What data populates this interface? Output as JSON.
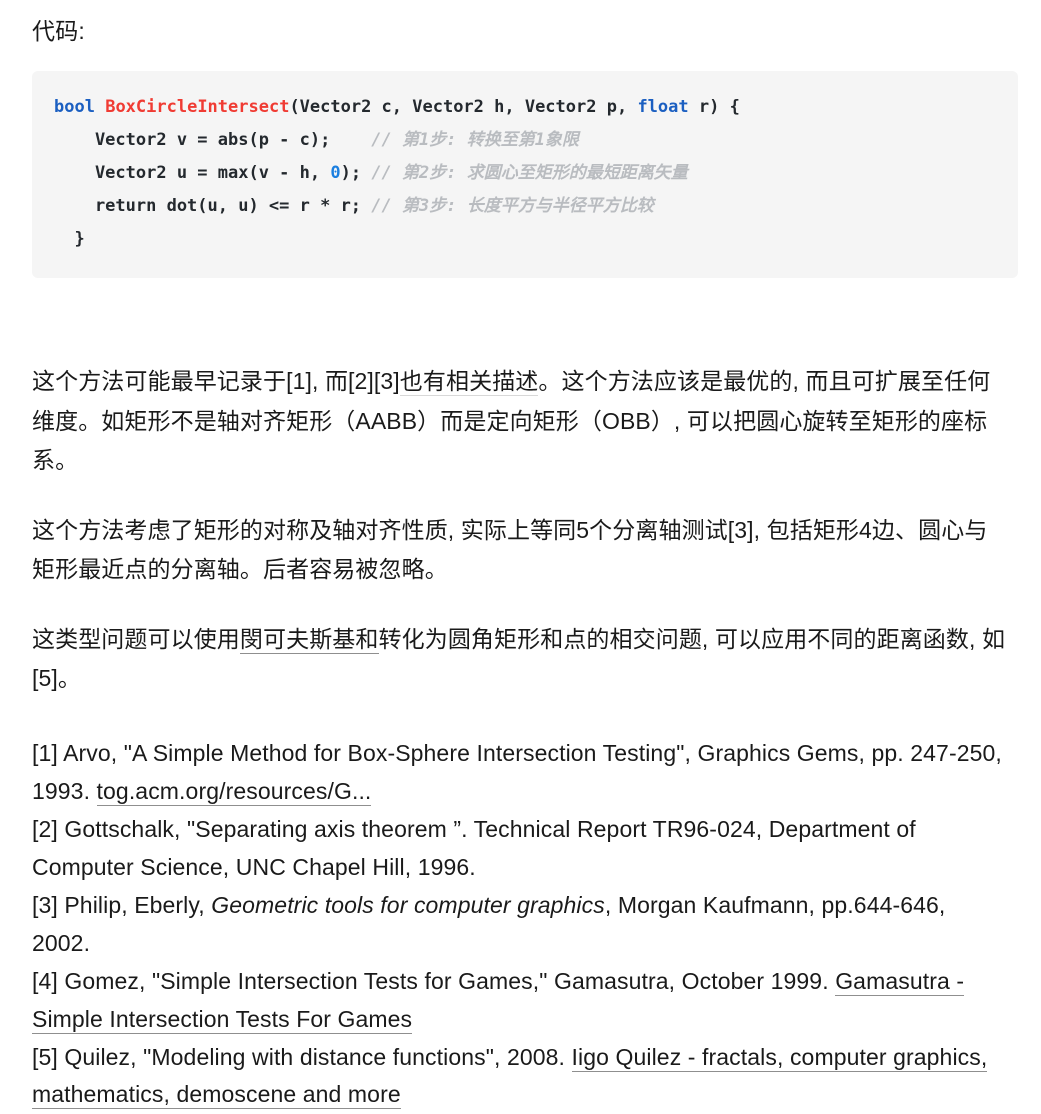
{
  "intro": {
    "label": "代码:"
  },
  "code": {
    "language": "cpp",
    "lines": [
      {
        "tokens": [
          {
            "t": "bool",
            "k": "kw"
          },
          {
            "t": " ",
            "k": "plain"
          },
          {
            "t": "BoxCircleIntersect",
            "k": "fn"
          },
          {
            "t": "(Vector2 c, Vector2 h, Vector2 p, ",
            "k": "plain"
          },
          {
            "t": "float",
            "k": "kw"
          },
          {
            "t": " r) {",
            "k": "plain"
          }
        ]
      },
      {
        "tokens": [
          {
            "t": "    Vector2 v = abs(p - c);    ",
            "k": "plain"
          },
          {
            "t": "// 第1步: 转换至第1象限",
            "k": "cmt"
          }
        ]
      },
      {
        "tokens": [
          {
            "t": "    Vector2 u = max(v - h, ",
            "k": "plain"
          },
          {
            "t": "0",
            "k": "num"
          },
          {
            "t": "); ",
            "k": "plain"
          },
          {
            "t": "// 第2步: 求圆心至矩形的最短距离矢量",
            "k": "cmt"
          }
        ]
      },
      {
        "tokens": [
          {
            "t": "    return dot(u, u) <= r * r; ",
            "k": "plain"
          },
          {
            "t": "// 第3步: 长度平方与半径平方比较",
            "k": "cmt"
          }
        ]
      },
      {
        "tokens": [
          {
            "t": "  }",
            "k": "plain"
          }
        ]
      }
    ]
  },
  "paragraphs": [
    {
      "id": "para-origin",
      "runs": [
        {
          "t": "这个方法可能最早记录于[1], 而[2][3]",
          "style": "plain"
        },
        {
          "t": "也有相关描述",
          "style": "link-faint"
        },
        {
          "t": "。这个方法应该是最优的, 而且可扩展至任何维度。如矩形不是轴对齐矩形（AABB）而是定向矩形（OBB）, 可以把圆心旋转至矩形的座标系。",
          "style": "plain"
        }
      ]
    },
    {
      "id": "para-sat",
      "runs": [
        {
          "t": "这个方法考虑了矩形的对称及轴对齐性质, 实际上等同5个分离轴测试[3], 包括矩形4边、圆心与矩形最近点的分离轴。后者容易被忽略。",
          "style": "plain"
        }
      ]
    },
    {
      "id": "para-minkowski",
      "runs": [
        {
          "t": "这类型问题可以使用",
          "style": "plain"
        },
        {
          "t": "閔可夫斯基和",
          "style": "link"
        },
        {
          "t": "转化为圆角矩形和点的相交问题, 可以应用不同的距离函数, 如[5]。",
          "style": "plain"
        }
      ]
    }
  ],
  "references": [
    {
      "id": "ref-1",
      "runs": [
        {
          "t": "[1] Arvo, \"A Simple Method for Box-Sphere Intersection Testing\", Graphics Gems, pp. 247-250, 1993. ",
          "style": "plain"
        },
        {
          "t": "tog.acm.org/resources/G...",
          "style": "link"
        }
      ]
    },
    {
      "id": "ref-2",
      "runs": [
        {
          "t": "[2] Gottschalk, \"Separating axis theorem ”. Technical Report TR96-024, Department of Computer Science, UNC Chapel Hill, 1996.",
          "style": "plain"
        }
      ]
    },
    {
      "id": "ref-3",
      "runs": [
        {
          "t": "[3] Philip, Eberly, ",
          "style": "plain"
        },
        {
          "t": "Geometric tools for computer graphics",
          "style": "italic"
        },
        {
          "t": ", Morgan Kaufmann, pp.644-646, 2002.",
          "style": "plain"
        }
      ]
    },
    {
      "id": "ref-4",
      "runs": [
        {
          "t": "[4] Gomez, \"Simple Intersection Tests for Games,\" Gamasutra, October 1999. ",
          "style": "plain"
        },
        {
          "t": "Gamasutra - Simple Intersection Tests For Games",
          "style": "link"
        }
      ]
    },
    {
      "id": "ref-5",
      "runs": [
        {
          "t": "[5] Quilez, \"Modeling with distance functions\", 2008. ",
          "style": "plain"
        },
        {
          "t": "Iigo Quilez - fractals, computer graphics, mathematics, demoscene and more",
          "style": "link"
        }
      ]
    }
  ],
  "colors": {
    "page_background": "#ffffff",
    "code_background": "#f5f5f5",
    "keyword": "#1b5fc1",
    "function_name": "#f03b33",
    "number_literal": "#1b7fe0",
    "comment": "#b9bcc0",
    "text": "#1a1a1a",
    "link_underline": "#8f8f8f"
  }
}
